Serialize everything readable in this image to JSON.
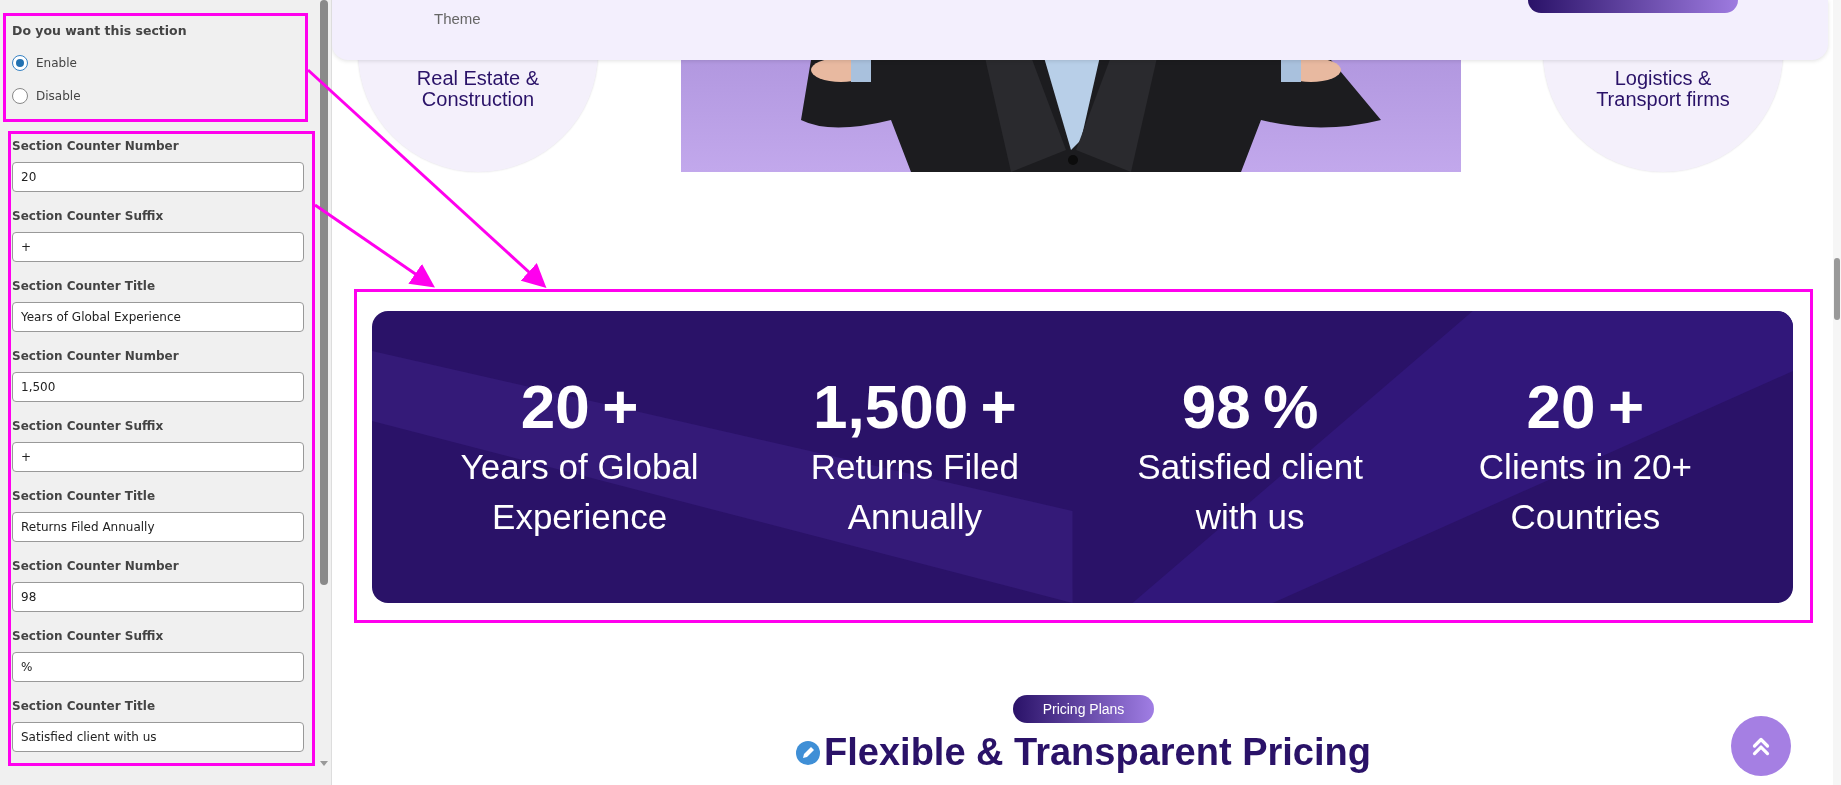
{
  "settings": {
    "question": "Do you want this section",
    "options": [
      {
        "label": "Enable",
        "selected": true
      },
      {
        "label": "Disable",
        "selected": false
      }
    ],
    "fields": [
      {
        "label": "Section Counter Number",
        "value": "20"
      },
      {
        "label": "Section Counter Suffix",
        "value": "+"
      },
      {
        "label": "Section Counter Title",
        "value": "Years of Global Experience"
      },
      {
        "label": "Section Counter Number",
        "value": "1,500"
      },
      {
        "label": "Section Counter Suffix",
        "value": "+"
      },
      {
        "label": "Section Counter Title",
        "value": "Returns Filed Annually"
      },
      {
        "label": "Section Counter Number",
        "value": "98"
      },
      {
        "label": "Section Counter Suffix",
        "value": "%"
      },
      {
        "label": "Section Counter Title",
        "value": "Satisfied client with us"
      }
    ]
  },
  "page": {
    "header_card": {
      "caption": "Theme"
    },
    "categories": [
      {
        "label": "Real Estate & Construction"
      },
      {
        "label": "Logistics & Transport firms"
      }
    ],
    "stats": [
      {
        "number": "20",
        "suffix": "+",
        "title": "Years of Global Experience"
      },
      {
        "number": "1,500",
        "suffix": "+",
        "title": "Returns Filed Annually"
      },
      {
        "number": "98",
        "suffix": "%",
        "title": "Satisfied client with us"
      },
      {
        "number": "20",
        "suffix": "+",
        "title": "Clients in 20+ Countries"
      }
    ],
    "pricing": {
      "badge": "Pricing Plans",
      "title": "Flexible & Transparent Pricing"
    }
  }
}
